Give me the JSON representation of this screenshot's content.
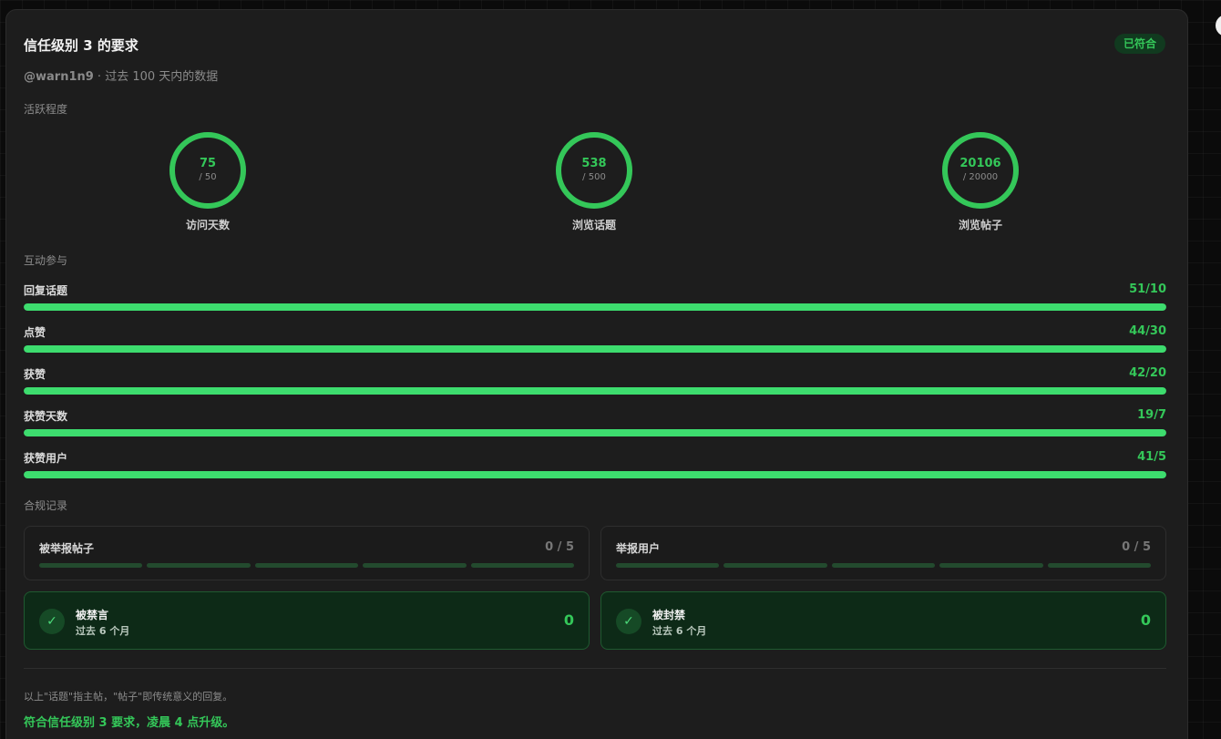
{
  "header": {
    "title": "信任级别 3 的要求",
    "badge": "已符合",
    "username": "@warn1n9",
    "subtitle_rest": " · 过去 100 天内的数据"
  },
  "sections": {
    "activity": "活跃程度",
    "interaction": "互动参与",
    "compliance": "合规记录"
  },
  "rings": [
    {
      "value": "75",
      "max": "/ 50",
      "label": "访问天数",
      "progress": 1.0
    },
    {
      "value": "538",
      "max": "/ 500",
      "label": "浏览话题",
      "progress": 1.0
    },
    {
      "value": "20106",
      "max": "/ 20000",
      "label": "浏览帖子",
      "progress": 1.0
    }
  ],
  "bars": [
    {
      "label": "回复话题",
      "value": "51/10",
      "progress": 1.0
    },
    {
      "label": "点赞",
      "value": "44/30",
      "progress": 1.0
    },
    {
      "label": "获赞",
      "value": "42/20",
      "progress": 1.0
    },
    {
      "label": "获赞天数",
      "value": "19/7",
      "progress": 1.0
    },
    {
      "label": "获赞用户",
      "value": "41/5",
      "progress": 1.0
    }
  ],
  "compliance": {
    "reported_posts": {
      "label": "被举报帖子",
      "value": "0 / 5",
      "filled": 0
    },
    "reported_users": {
      "label": "举报用户",
      "value": "0 / 5",
      "filled": 0
    },
    "silenced": {
      "title": "被禁言",
      "sub": "过去 6 个月",
      "value": "0"
    },
    "suspended": {
      "title": "被封禁",
      "sub": "过去 6 个月",
      "value": "0"
    }
  },
  "footer": {
    "note": "以上\"话题\"指主帖，\"帖子\"即传统意义的回复。",
    "result": "符合信任级别 3 要求，凌晨 4 点升级。"
  },
  "colors": {
    "accent": "#34c759",
    "track": "#2a2a2a"
  }
}
